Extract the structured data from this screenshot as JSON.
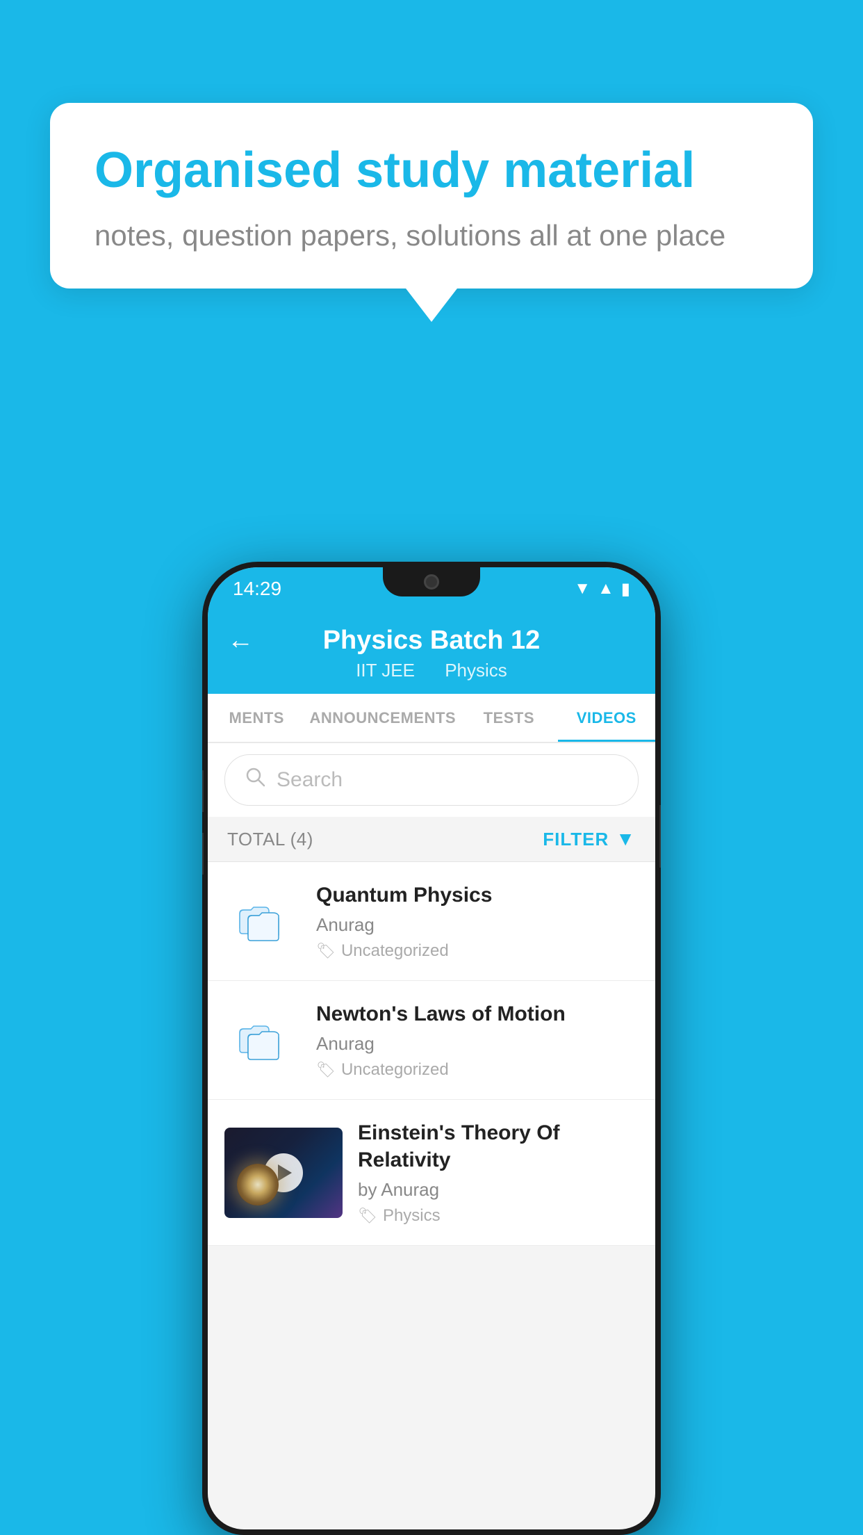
{
  "background_color": "#1ab8e8",
  "speech_bubble": {
    "title": "Organised study material",
    "subtitle": "notes, question papers, solutions all at one place"
  },
  "phone": {
    "status_bar": {
      "time": "14:29",
      "wifi": "▼",
      "signal": "▲",
      "battery": "▮"
    },
    "header": {
      "back_label": "←",
      "title": "Physics Batch 12",
      "subtitle_left": "IIT JEE",
      "subtitle_right": "Physics"
    },
    "tabs": [
      {
        "label": "MENTS",
        "active": false
      },
      {
        "label": "ANNOUNCEMENTS",
        "active": false
      },
      {
        "label": "TESTS",
        "active": false
      },
      {
        "label": "VIDEOS",
        "active": true
      }
    ],
    "search": {
      "placeholder": "Search"
    },
    "filter_bar": {
      "total_label": "TOTAL (4)",
      "filter_label": "FILTER"
    },
    "videos": [
      {
        "id": 1,
        "title": "Quantum Physics",
        "author": "Anurag",
        "tag": "Uncategorized",
        "type": "folder"
      },
      {
        "id": 2,
        "title": "Newton's Laws of Motion",
        "author": "Anurag",
        "tag": "Uncategorized",
        "type": "folder"
      },
      {
        "id": 3,
        "title": "Einstein's Theory Of Relativity",
        "author": "by Anurag",
        "tag": "Physics",
        "type": "video"
      }
    ]
  }
}
